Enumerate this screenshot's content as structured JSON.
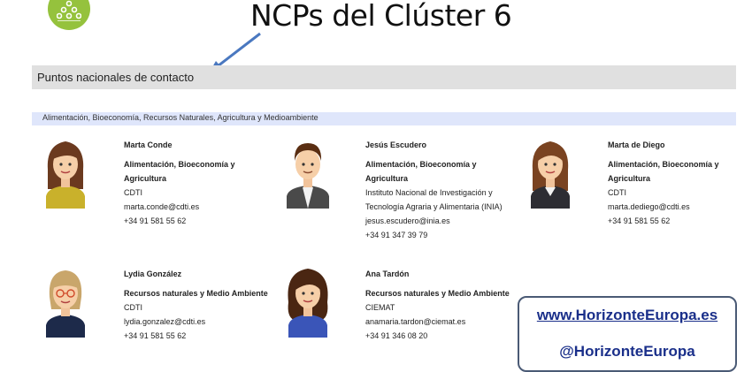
{
  "slide_title": "NCPs del Clúster 6",
  "section_header": "Puntos nacionales de contacto",
  "category": "Alimentación, Bioeconomía, Recursos Naturales, Agricultura y Medioambiente",
  "contacts": [
    {
      "name": "Marta Conde",
      "area": [
        "Alimentación, Bioeconomía y",
        "Agricultura"
      ],
      "org": [
        "CDTI"
      ],
      "email": "marta.conde@cdti.es",
      "phone": "+34 91 581 55 62"
    },
    {
      "name": "Jesús Escudero",
      "area": [
        "Alimentación, Bioeconomía y",
        "Agricultura"
      ],
      "org": [
        "Instituto Nacional de Investigación y",
        "Tecnología Agraria y Alimentaria (INIA)"
      ],
      "email": "jesus.escudero@inia.es",
      "phone": "+34 91 347 39 79"
    },
    {
      "name": "Marta de Diego",
      "area": [
        "Alimentación, Bioeconomía y",
        "Agricultura"
      ],
      "org": [
        "CDTI"
      ],
      "email": "marta.dediego@cdti.es",
      "phone": "+34 91 581 55 62"
    },
    {
      "name": "Lydia González",
      "area": [
        "Recursos naturales y Medio Ambiente"
      ],
      "org": [
        "CDTI"
      ],
      "email": "lydia.gonzalez@cdti.es",
      "phone": "+34 91 581 55 62"
    },
    {
      "name": "Ana Tardón",
      "area": [
        "Recursos naturales y Medio Ambiente"
      ],
      "org": [
        "CIEMAT"
      ],
      "email": "anamaria.tardon@ciemat.es",
      "phone": "+34 91 346 08 20"
    }
  ],
  "promo": {
    "url": "www.HorizonteEuropa.es",
    "handle": "@HorizonteEuropa"
  },
  "colors": {
    "logo": "#95c23d",
    "section_bar": "#e0e0e0",
    "category_bar": "#dfe6fb",
    "arrow": "#4a78c0",
    "promo_text": "#1a2f8a"
  },
  "icons": {
    "logo": "people-pyramid-icon",
    "arrow": "arrow-icon"
  }
}
